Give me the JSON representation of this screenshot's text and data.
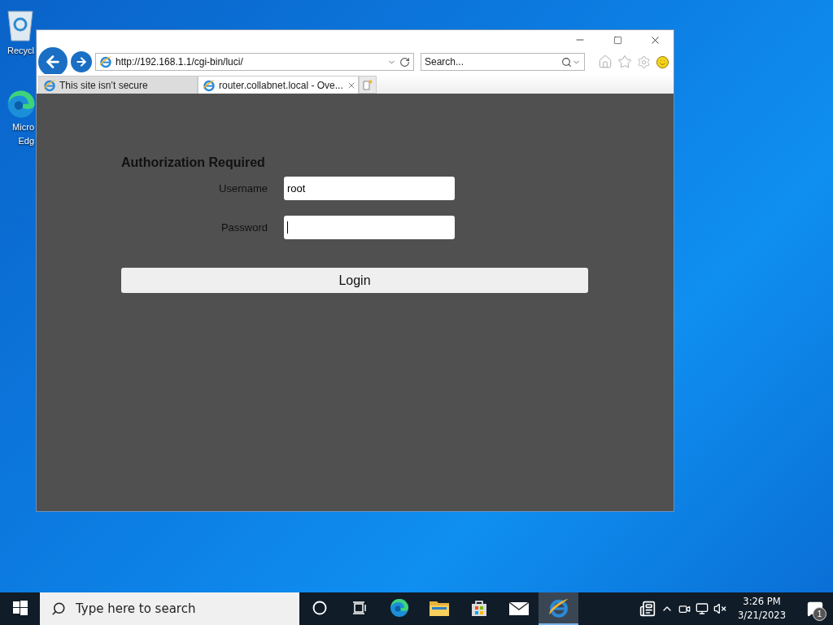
{
  "desktop": {
    "icons": [
      {
        "kind": "recycle",
        "lines": [
          "Recycl"
        ]
      },
      {
        "kind": "edge",
        "lines": [
          "Micro",
          "Edg"
        ]
      }
    ]
  },
  "browser": {
    "address": "http://192.168.1.1/cgi-bin/luci/",
    "search": {
      "placeholder": "Search..."
    },
    "tabs": [
      {
        "label": "This site isn’t secure",
        "selected": false
      },
      {
        "label": "router.collabnet.local - Ove...",
        "selected": true
      }
    ],
    "page": {
      "heading": "Authorization Required",
      "fields": [
        {
          "label": "Username",
          "value": "root",
          "focused": false
        },
        {
          "label": "Password",
          "focused": true
        }
      ],
      "button": "Login"
    }
  },
  "taskbar": {
    "search": {
      "placeholder": "Type here to search"
    },
    "apps": [
      {
        "kind": "cortana",
        "active": false
      },
      {
        "kind": "taskview",
        "active": false
      },
      {
        "kind": "edge",
        "active": false
      },
      {
        "kind": "explorer",
        "active": false
      },
      {
        "kind": "store",
        "active": false
      },
      {
        "kind": "mail",
        "active": false
      },
      {
        "kind": "ie",
        "active": true
      }
    ],
    "time": "3:26 PM",
    "date": "3/21/2023",
    "notifications": "1"
  }
}
